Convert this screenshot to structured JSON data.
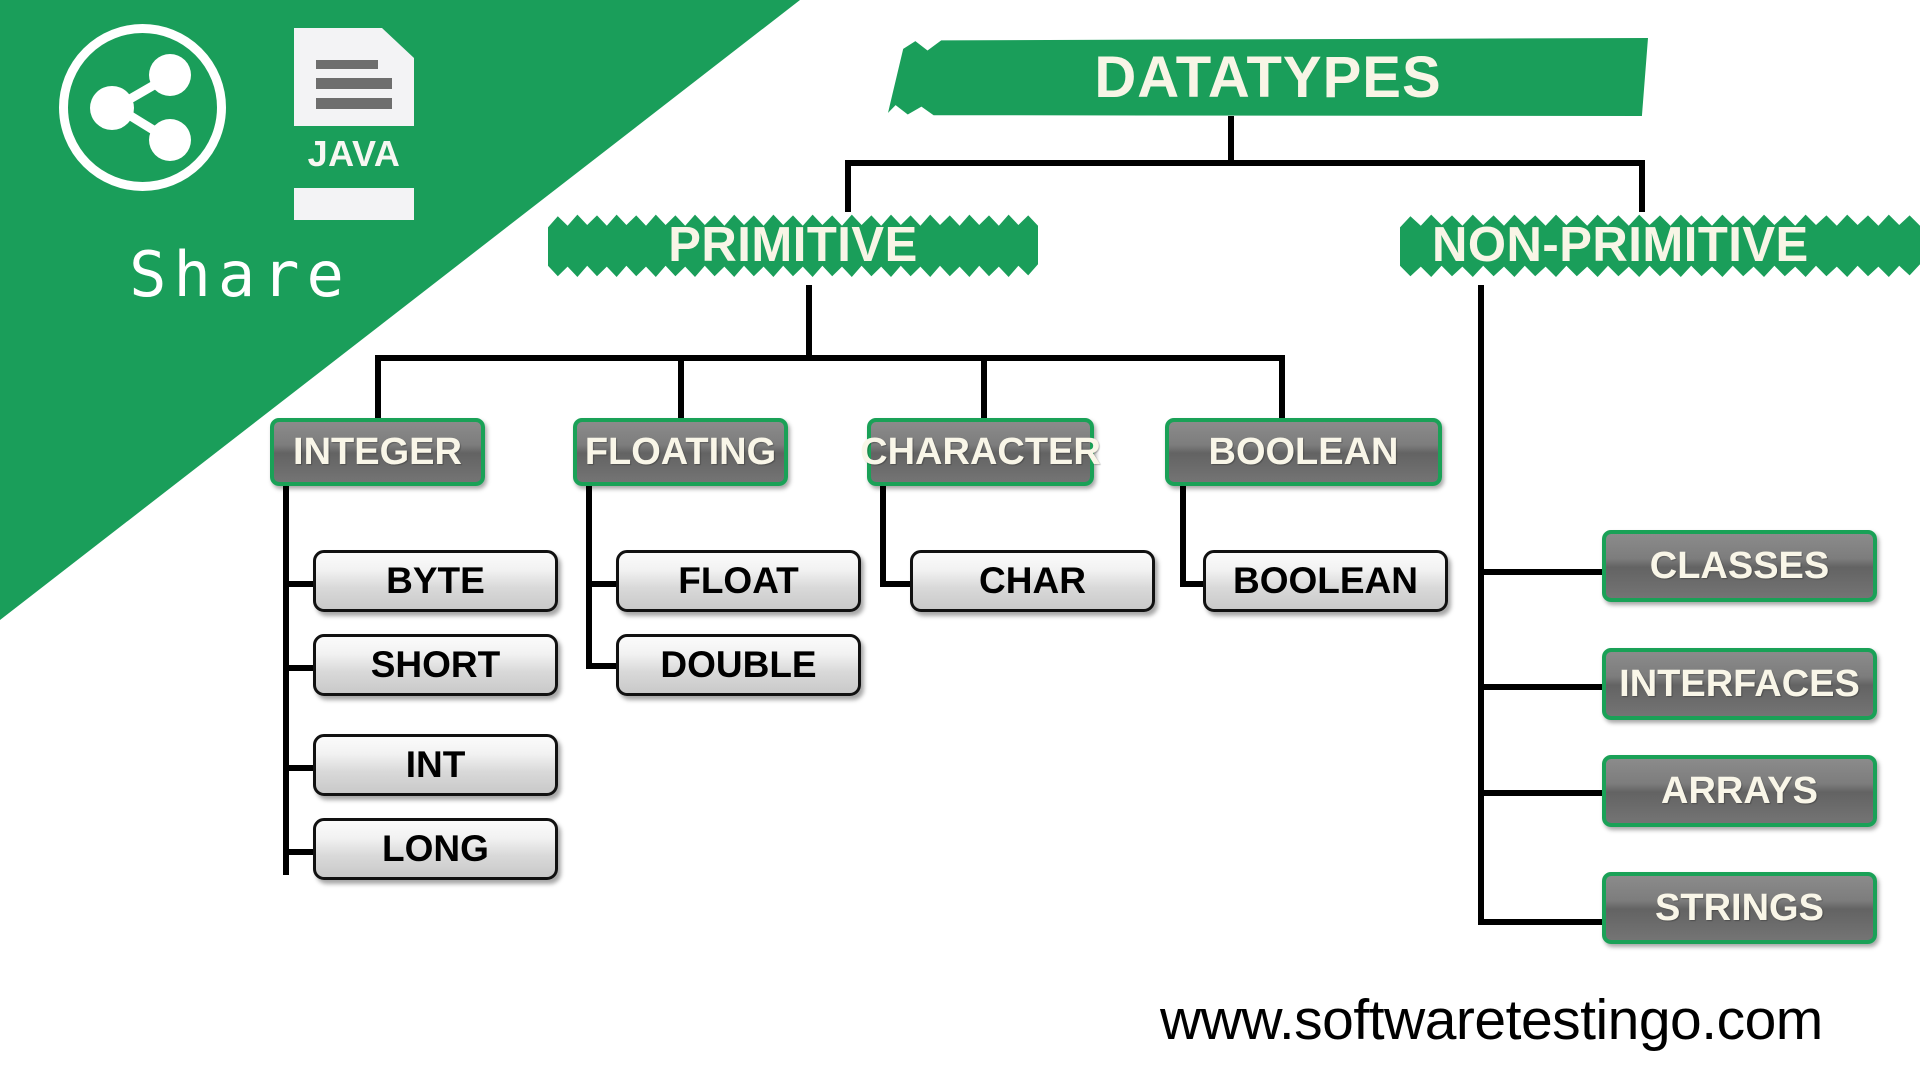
{
  "brand": {
    "share_label": "Share",
    "java_label": "JAVA",
    "share_icon": "share-network-icon",
    "file_icon": "java-file-icon"
  },
  "diagram": {
    "title": "DATATYPES",
    "branches": [
      {
        "label": "PRIMITIVE"
      },
      {
        "label": "NON-PRIMITIVE"
      }
    ],
    "primitive_categories": [
      {
        "label": "INTEGER",
        "children": [
          "BYTE",
          "SHORT",
          "INT",
          "LONG"
        ]
      },
      {
        "label": "FLOATING",
        "children": [
          "FLOAT",
          "DOUBLE"
        ]
      },
      {
        "label": "CHARACTER",
        "children": [
          "CHAR"
        ]
      },
      {
        "label": "BOOLEAN",
        "children": [
          "BOOLEAN"
        ]
      }
    ],
    "nonprimitive_items": [
      {
        "label": "CLASSES"
      },
      {
        "label": "INTERFACES"
      },
      {
        "label": "ARRAYS"
      },
      {
        "label": "STRINGS"
      }
    ]
  },
  "footer": {
    "website": "www.softwaretestingo.com"
  },
  "colors": {
    "brand_green": "#1a9e5a",
    "box_border_green": "#1aa157",
    "cream_text": "#f9f6e8",
    "line_black": "#000000"
  },
  "labels": {
    "integer": "INTEGER",
    "floating": "FLOATING",
    "character": "CHARACTER",
    "boolean_cat": "BOOLEAN",
    "byte": "BYTE",
    "short": "SHORT",
    "int": "INT",
    "long": "LONG",
    "float": "FLOAT",
    "double": "DOUBLE",
    "char": "CHAR",
    "boolean_leaf": "BOOLEAN",
    "classes": "CLASSES",
    "interfaces": "INTERFACES",
    "arrays": "ARRAYS",
    "strings": "STRINGS"
  }
}
